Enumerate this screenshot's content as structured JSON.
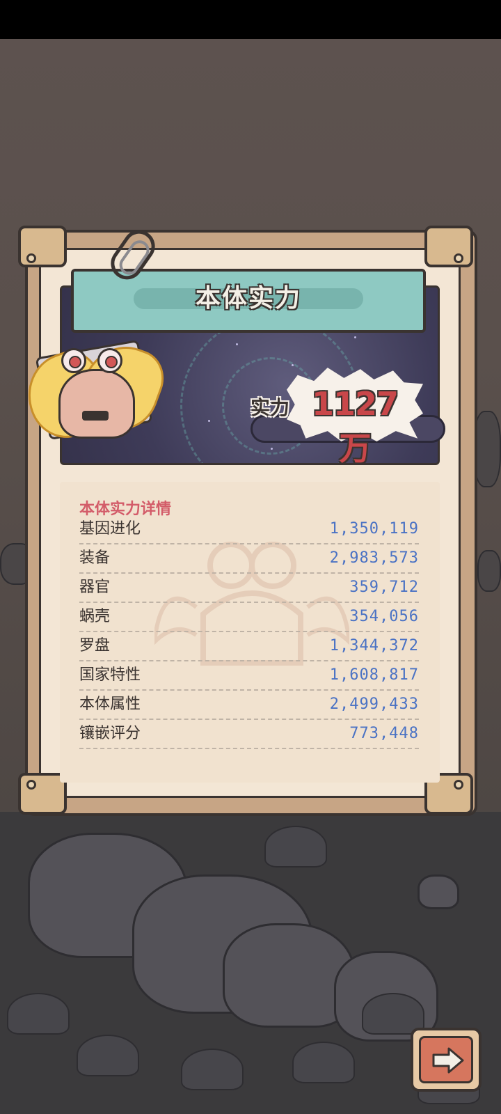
{
  "panel": {
    "title": "本体实力",
    "power_label": "实力",
    "power_value": "1127万"
  },
  "details": {
    "heading": "本体实力详情",
    "rows": [
      {
        "name": "基因进化",
        "value": "1,350,119"
      },
      {
        "name": "装备",
        "value": "2,983,573"
      },
      {
        "name": "器官",
        "value": "359,712"
      },
      {
        "name": "蜗壳",
        "value": "354,056"
      },
      {
        "name": "罗盘",
        "value": "1,344,372"
      },
      {
        "name": "国家特性",
        "value": "1,608,817"
      },
      {
        "name": "本体属性",
        "value": "2,499,433"
      },
      {
        "name": "镶嵌评分",
        "value": "773,448"
      }
    ]
  },
  "colors": {
    "title_text": "#f3efe6",
    "banner": "#8ec9c2",
    "power_value": "#c9474a",
    "detail_heading": "#d35c69",
    "detail_value": "#4a72c4"
  },
  "icons": {
    "next": "right-arrow-icon",
    "clip": "paperclip-icon"
  }
}
